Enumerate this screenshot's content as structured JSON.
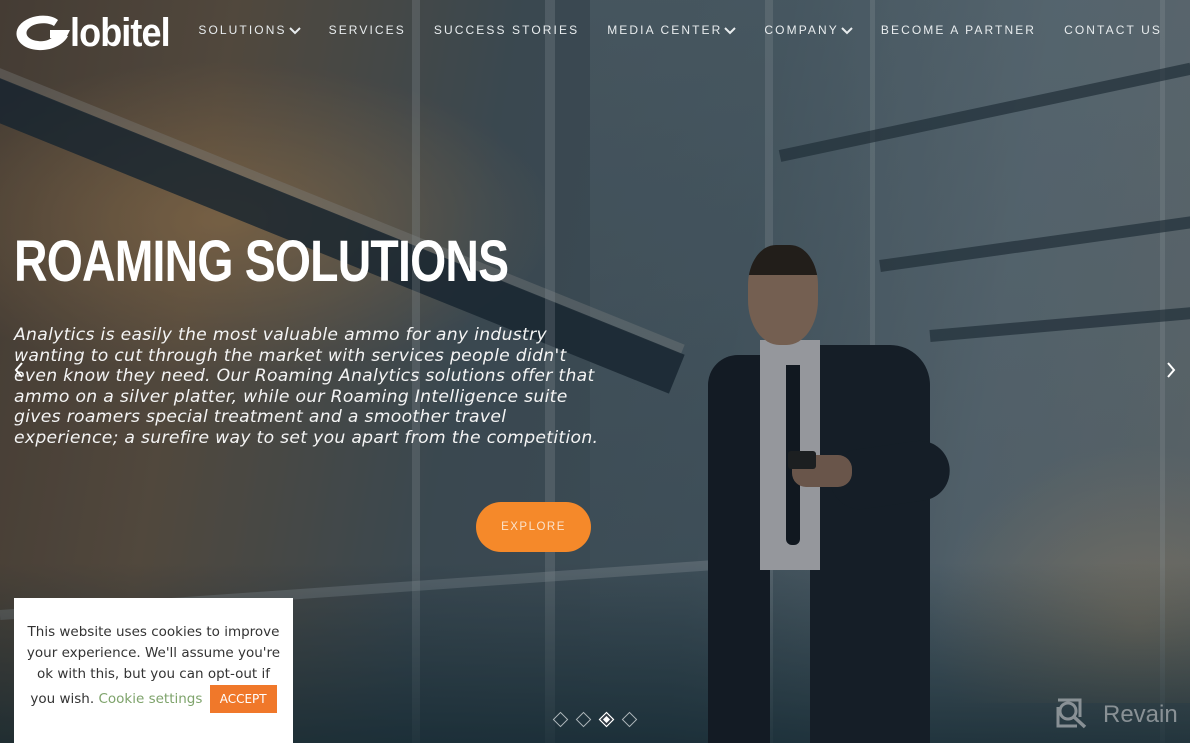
{
  "brand": {
    "name": "lobitel",
    "full_name": "Globitel",
    "accent": "#f5892a"
  },
  "nav": {
    "items": [
      {
        "label": "SOLUTIONS",
        "has_dropdown": true
      },
      {
        "label": "SERVICES",
        "has_dropdown": false
      },
      {
        "label": "SUCCESS STORIES",
        "has_dropdown": false
      },
      {
        "label": "MEDIA CENTER",
        "has_dropdown": true
      },
      {
        "label": "COMPANY",
        "has_dropdown": true
      },
      {
        "label": "BECOME A PARTNER",
        "has_dropdown": false
      },
      {
        "label": "CONTACT US",
        "has_dropdown": false
      }
    ]
  },
  "slider": {
    "title": "ROAMING SOLUTIONS",
    "text": "Analytics is easily the most valuable ammo for any industry wanting to cut through the market with services people didn't even know they need. Our Roaming Analytics solutions offer that ammo on a silver platter, while our Roaming Intelligence suite gives roamers special treatment and a smoother travel experience; a surefire way to set you apart from the competition.",
    "cta_label": "EXPLORE",
    "prev_icon": "chevron-left-icon",
    "next_icon": "chevron-right-icon",
    "total_slides": 4,
    "active_slide": 3
  },
  "cookie_banner": {
    "message": "This website uses cookies to improve your experience. We'll assume you're ok with this, but you can opt-out if you wish.",
    "settings_label": "Cookie settings",
    "accept_label": "ACCEPT",
    "link_color": "#7ea36b",
    "accept_color": "#f0782a"
  },
  "watermark": {
    "label": "Revain"
  }
}
